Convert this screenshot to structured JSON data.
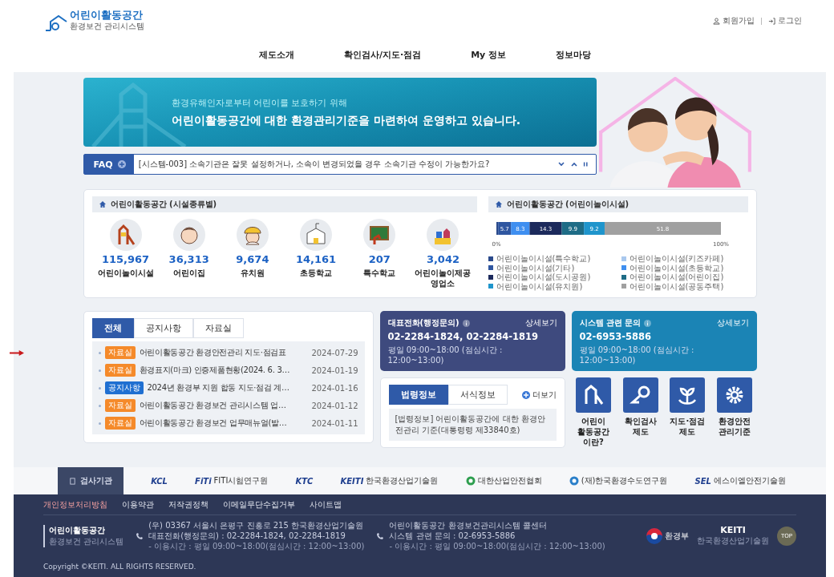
{
  "header": {
    "logo": {
      "title": "어린이활동공간",
      "subtitle": "환경보건 관리시스템"
    },
    "user_links": [
      {
        "kind": "join",
        "label": "회원가입"
      },
      {
        "kind": "login",
        "label": "로그인"
      }
    ]
  },
  "nav": [
    "제도소개",
    "확인검사/지도·점검",
    "My 정보",
    "정보마당"
  ],
  "banner": {
    "subtitle": "환경유해인자로부터 어린이를 보호하기 위해",
    "title": "어린이활동공간에 대한 환경관리기준을 마련하여 운영하고 있습니다."
  },
  "faq": {
    "label": "FAQ",
    "question": "[시스템-003] 소속기관은 잘못 설정하거나, 소속이 변경되었을 경우 소속기관 수정이 가능한가요?"
  },
  "facilities": {
    "title": "어린이활동공간 (시설종류별)",
    "items": [
      {
        "kind": "playground",
        "count": "115,967",
        "label": "어린이놀이시설"
      },
      {
        "kind": "baby",
        "count": "36,313",
        "label": "어린이집"
      },
      {
        "kind": "kid",
        "count": "9,674",
        "label": "유치원"
      },
      {
        "kind": "school",
        "count": "14,161",
        "label": "초등학교"
      },
      {
        "kind": "board",
        "count": "207",
        "label": "특수학교"
      },
      {
        "kind": "blocks",
        "count": "3,042",
        "label": "어린이놀이제공 영업소"
      }
    ]
  },
  "facility_chart": {
    "title": "어린이활동공간 (어린이놀이시설)",
    "chart_data": {
      "type": "bar",
      "orientation": "horizontal",
      "stacked": true,
      "categories": [
        null
      ],
      "value_labels": [
        [
          null
        ],
        [
          null
        ],
        [
          "5.7"
        ],
        [
          "8.3"
        ],
        [
          "14.3"
        ],
        [
          "9.9"
        ],
        [
          "9.2"
        ],
        [
          "51.8"
        ]
      ],
      "xlim": [
        0,
        100
      ],
      "xticks": [
        {
          "value": 0,
          "label": "0%"
        },
        {
          "value": 100,
          "label": "100%"
        }
      ],
      "series": [
        {
          "name": "어린이놀이시설(특수학교)",
          "color": "#2b4a8b",
          "values": [
            0.8
          ]
        },
        {
          "name": "어린이놀이시설(키즈카페)",
          "color": "#a9c8ee",
          "values": [
            null
          ]
        },
        {
          "name": "어린이놀이시설(기타)",
          "color": "#2f56a0",
          "values": [
            5.7
          ]
        },
        {
          "name": "어린이놀이시설(초등학교)",
          "color": "#3f8ff0",
          "values": [
            8.3
          ]
        },
        {
          "name": "어린이놀이시설(도시공원)",
          "color": "#1c2a5c",
          "values": [
            14.3
          ]
        },
        {
          "name": "어린이놀이시설(어린이집)",
          "color": "#1e6c86",
          "values": [
            9.9
          ]
        },
        {
          "name": "어린이놀이시설(유치원)",
          "color": "#1f95cc",
          "values": [
            9.2
          ]
        },
        {
          "name": "어린이놀이시설(공동주택)",
          "color": "#a0a0a0",
          "values": [
            51.8
          ]
        }
      ]
    }
  },
  "notices": {
    "tabs": [
      {
        "label": "전체",
        "selected": true
      },
      {
        "label": "공지사항",
        "selected": false
      },
      {
        "label": "자료실",
        "selected": false
      }
    ],
    "items": [
      {
        "tag": "자료실",
        "color": "#f58a2a",
        "title": "어린이활동공간 환경안전관리 지도·점검표",
        "date": "2024-07-29"
      },
      {
        "tag": "자료실",
        "color": "#f58a2a",
        "title": "환경표지(마크) 인증제품현황(2024. 6. 3…",
        "date": "2024-01-19"
      },
      {
        "tag": "공지사항",
        "color": "#1f6fd1",
        "title": "2024년 환경부 지원 합동 지도·점검 계…",
        "date": "2024-01-16"
      },
      {
        "tag": "자료실",
        "color": "#f58a2a",
        "title": "어린이활동공간 환경보건 관리시스템 업…",
        "date": "2024-01-12"
      },
      {
        "tag": "자료실",
        "color": "#f58a2a",
        "title": "어린이활동공간 환경보건 업무매뉴얼(발…",
        "date": "2024-01-11"
      }
    ]
  },
  "contacts": [
    {
      "title": "대표전화(행정문의)",
      "link": "상세보기",
      "phone": "02-2284-1824, 02-2284-1819",
      "hours": "평일 09:00~18:00 (점심시간 : 12:00~13:00)",
      "color": "#3e4a7e"
    },
    {
      "title": "시스템 관련 문의",
      "link": "상세보기",
      "phone": "02-6953-5886",
      "hours": "평일 09:00~18:00 (점심시간 : 12:00~13:00)",
      "color": "#1b84b5"
    }
  ],
  "law": {
    "tabs": [
      {
        "label": "법령정보",
        "selected": true
      },
      {
        "label": "서식정보",
        "selected": false
      }
    ],
    "more": "더보기",
    "text": "[법령정보] 어린이활동공간에 대한 환경안전관리 기준(대통령령 제33840호)"
  },
  "quick_links": [
    {
      "kind": "playground",
      "lines": [
        "어린이",
        "활동공간",
        "이란?"
      ]
    },
    {
      "kind": "inspect",
      "lines": [
        "확인검사",
        "제도"
      ]
    },
    {
      "kind": "plant",
      "lines": [
        "지도·점검",
        "제도"
      ]
    },
    {
      "kind": "gear",
      "lines": [
        "환경안전",
        "관리기준"
      ]
    }
  ],
  "partners": {
    "label": "검사기관",
    "items": [
      {
        "mark": "KCL"
      },
      {
        "mark": "FiTi",
        "name": "FITI시험연구원"
      },
      {
        "mark": "KTC"
      },
      {
        "mark": "KEITI",
        "name": "한국환경산업기술원"
      },
      {
        "color": "#2e9e4f",
        "name": "대한산업안전협회"
      },
      {
        "color": "#2a7fc9",
        "name": "(재)한국환경수도연구원"
      },
      {
        "mark": "SEL",
        "name": "에스이엘안전기술원"
      }
    ]
  },
  "footer": {
    "links": [
      {
        "label": "개인정보처리방침",
        "highlight": true
      },
      {
        "label": "이용약관",
        "highlight": false
      },
      {
        "label": "저작권정책",
        "highlight": false
      },
      {
        "label": "이메일무단수집거부",
        "highlight": false
      },
      {
        "label": "사이트맵",
        "highlight": false
      }
    ],
    "logo": {
      "title": "어린이활동공간",
      "subtitle": "환경보건 관리시스템"
    },
    "columns": [
      {
        "heading": "(우) 03367 서울시 은평구 진흥로 215 한국환경산업기술원",
        "phone": "대표전화(행정문의) : 02-2284-1824, 02-2284-1819",
        "hours": "- 이용시간 : 평일 09:00~18:00(점심시간 : 12:00~13:00)"
      },
      {
        "heading": "어린이활동공간 환경보건관리시스템 콜센터",
        "phone": "시스템 관련 문의 : 02-6953-5886",
        "hours": "- 이용시간 : 평일 09:00~18:00(점심시간 : 12:00~13:00)"
      }
    ],
    "ministry": "환경부",
    "keiti": {
      "mark": "KEITI",
      "name": "한국환경산업기술원"
    },
    "top": "TOP",
    "copyright": "Copyright ©KEITI. ALL RIGHTS RESERVED."
  }
}
